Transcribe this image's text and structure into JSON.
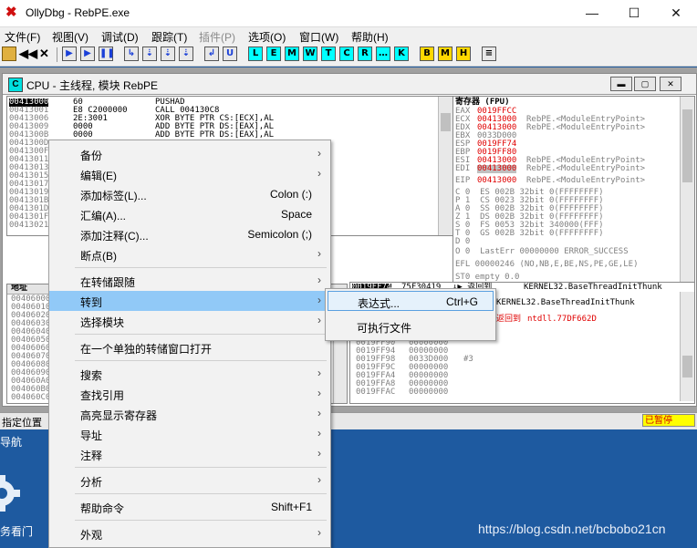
{
  "window": {
    "title": "OllyDbg - RebPE.exe",
    "controls": {
      "minimize": "—",
      "maximize": "☐",
      "close": "✕"
    }
  },
  "menu": [
    "文件(F)",
    "视图(V)",
    "调试(D)",
    "跟踪(T)",
    "插件(P)",
    "选项(O)",
    "窗口(W)",
    "帮助(H)"
  ],
  "toolbar": {
    "buttons": [
      "▶",
      "▶",
      "❚❚",
      "↳",
      "⇣",
      "⇣",
      "⇣",
      "↲",
      "U",
      "L",
      "E",
      "M",
      "W",
      "T",
      "C",
      "R",
      "…",
      "K",
      "B",
      "M",
      "H",
      "≡"
    ]
  },
  "cpu": {
    "title": "CPU - 主线程, 模块 RebPE",
    "disasm": [
      {
        "addr": "00413000",
        "hex": "60",
        "asm": "PUSHAD"
      },
      {
        "addr": "00413001",
        "hex": "E8 C2000000",
        "asm": "CALL 004130C8"
      },
      {
        "addr": "00413006",
        "hex": "2E:3001",
        "asm": "XOR BYTE PTR CS:[ECX],AL"
      },
      {
        "addr": "00413009",
        "hex": "0000",
        "asm": "ADD BYTE PTR DS:[EAX],AL"
      },
      {
        "addr": "0041300B",
        "hex": "0000",
        "asm": "ADD BYTE PTR DS:[EAX],AL"
      },
      {
        "addr": "0041300D",
        "hex": "",
        "asm": ""
      },
      {
        "addr": "0041300F",
        "hex": "",
        "asm": ""
      },
      {
        "addr": "00413011",
        "hex": "",
        "asm": ""
      },
      {
        "addr": "00413013",
        "hex": "",
        "asm": ""
      },
      {
        "addr": "00413015",
        "hex": "",
        "asm": ""
      },
      {
        "addr": "00413017",
        "hex": "",
        "asm": ""
      },
      {
        "addr": "00413019",
        "hex": "",
        "asm": ""
      },
      {
        "addr": "0041301B",
        "hex": "",
        "asm": ""
      },
      {
        "addr": "0041301D",
        "hex": "",
        "asm": ""
      },
      {
        "addr": "0041301F",
        "hex": "",
        "asm": ""
      },
      {
        "addr": "00413021",
        "hex": "",
        "asm": ""
      }
    ],
    "registers": {
      "header": "寄存器 (FPU)",
      "lines": [
        {
          "name": "EAX",
          "value": "0019FFCC",
          "comment": ""
        },
        {
          "name": "ECX",
          "value": "00413000",
          "comment": "RebPE.<ModuleEntryPoint>"
        },
        {
          "name": "EDX",
          "value": "00413000",
          "comment": "RebPE.<ModuleEntryPoint>"
        },
        {
          "name": "EBX",
          "value": "0033D000",
          "comment": ""
        },
        {
          "name": "ESP",
          "value": "0019FF74",
          "comment": ""
        },
        {
          "name": "EBP",
          "value": "0019FF80",
          "comment": ""
        },
        {
          "name": "ESI",
          "value": "00413000",
          "comment": "RebPE.<ModuleEntryPoint>"
        },
        {
          "name": "EDI",
          "value": "00413000",
          "comment": "RebPE.<ModuleEntryPoint>"
        },
        {
          "name": "",
          "value": "",
          "comment": ""
        },
        {
          "name": "EIP",
          "value": "00413000",
          "comment": "RebPE.<ModuleEntryPoint>"
        }
      ],
      "flags": [
        "C 0  ES 002B 32bit 0(FFFFFFFF)",
        "P 1  CS 0023 32bit 0(FFFFFFFF)",
        "A 0  SS 002B 32bit 0(FFFFFFFF)",
        "Z 1  DS 002B 32bit 0(FFFFFFFF)",
        "S 0  FS 0053 32bit 340000(FFF)",
        "T 0  GS 002B 32bit 0(FFFFFFFF)",
        "D 0",
        "O 0  LastErr 00000000 ERROR_SUCCESS",
        "",
        "EFL 00000246 (NO,NB,E,BE,NS,PE,GE,LE)",
        "",
        "ST0 empty 0.0"
      ]
    },
    "dump": {
      "header": "地址",
      "addrs": [
        "00406000",
        "00406010",
        "00406020",
        "00406030",
        "00406040",
        "00406050",
        "00406060",
        "00406070",
        "00406080",
        "00406090",
        "004060A0",
        "004060B0",
        "004060C0"
      ]
    },
    "stack": {
      "selected": "0019FF74",
      "next": "75F30419",
      "arrow": "↓▶ 返回到",
      "comment_header": "KERNEL32.BaseThreadInitThunk",
      "comment_1": "KERNEL32.BaseThreadInitThunk",
      "ret_label": "返回到",
      "ret_target": "ntdll.77DF662D",
      "hash": "#3",
      "rows": [
        {
          "addr": "0019FF90",
          "val": "00000000"
        },
        {
          "addr": "0019FF94",
          "val": "00000000"
        },
        {
          "addr": "0019FF98",
          "val": "0033D000"
        },
        {
          "addr": "0019FF9C",
          "val": "00000000"
        },
        {
          "addr": "0019FFA4",
          "val": "00000000"
        },
        {
          "addr": "0019FFA8",
          "val": "00000000"
        },
        {
          "addr": "0019FFAC",
          "val": "00000000"
        }
      ]
    }
  },
  "status": {
    "left": "指定位置",
    "right": "已暂停"
  },
  "context_menu": [
    {
      "label": "备份",
      "shortcut": "",
      "sub": true
    },
    {
      "label": "编辑(E)",
      "shortcut": "",
      "sub": true
    },
    {
      "label": "添加标签(L)...",
      "shortcut": "Colon (:)",
      "sub": false
    },
    {
      "label": "汇编(A)...",
      "shortcut": "Space",
      "sub": false
    },
    {
      "label": "添加注释(C)...",
      "shortcut": "Semicolon (;)",
      "sub": false
    },
    {
      "label": "断点(B)",
      "shortcut": "",
      "sub": true
    },
    {
      "label": "在转储跟随",
      "shortcut": "",
      "sub": true
    },
    {
      "label": "转到",
      "shortcut": "",
      "sub": true
    },
    {
      "label": "选择模块",
      "shortcut": "",
      "sub": true
    },
    {
      "label": "在一个单独的转储窗口打开",
      "shortcut": "",
      "sub": false
    },
    {
      "label": "搜索",
      "shortcut": "",
      "sub": true
    },
    {
      "label": "查找引用",
      "shortcut": "",
      "sub": true
    },
    {
      "label": "高亮显示寄存器",
      "shortcut": "",
      "sub": true
    },
    {
      "label": "导址",
      "shortcut": "",
      "sub": true
    },
    {
      "label": "注释",
      "shortcut": "",
      "sub": true
    },
    {
      "label": "分析",
      "shortcut": "",
      "sub": true
    },
    {
      "label": "帮助命令",
      "shortcut": "Shift+F1",
      "sub": false
    },
    {
      "label": "外观",
      "shortcut": "",
      "sub": true
    }
  ],
  "submenu": [
    {
      "label": "表达式...",
      "shortcut": "Ctrl+G"
    },
    {
      "label": "可执行文件",
      "shortcut": ""
    }
  ],
  "desktop": {
    "nav": "导航",
    "door": "务看门"
  },
  "watermark": "https://blog.csdn.net/bcbobo21cn"
}
